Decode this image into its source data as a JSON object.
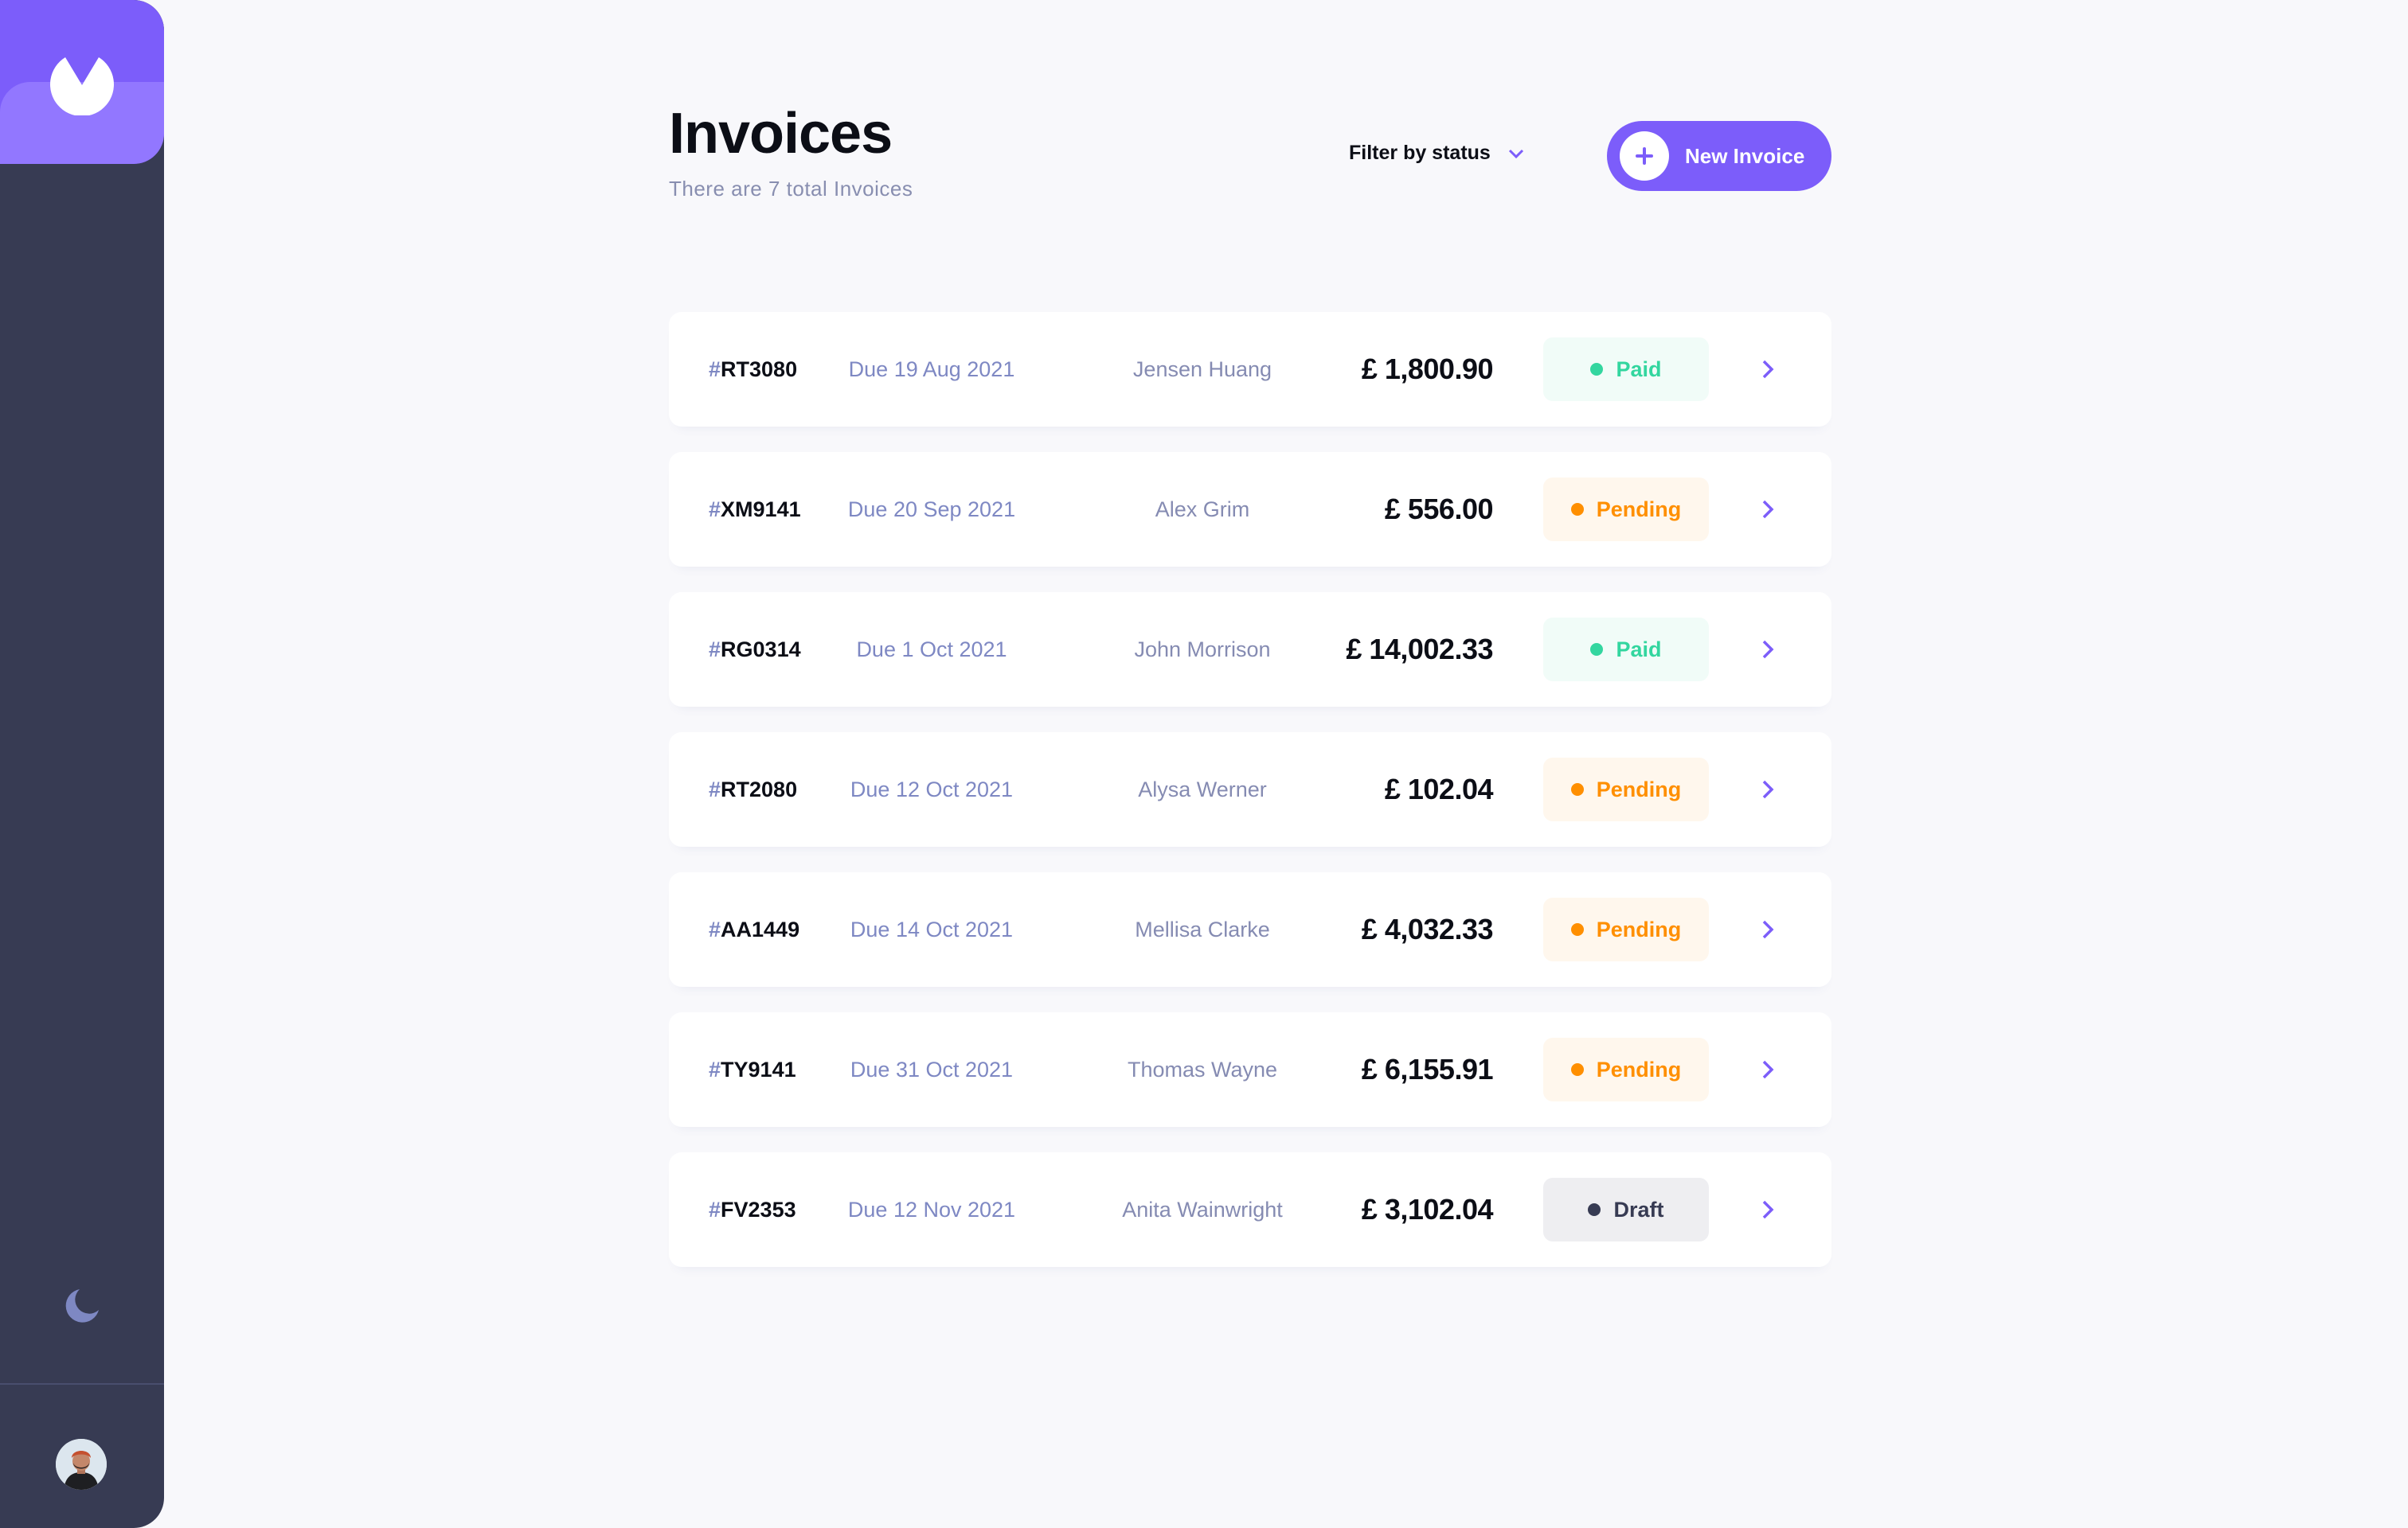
{
  "colors": {
    "accent": "#7C5DFA",
    "accent_light": "#9277FF",
    "sidebar": "#373B53",
    "paid": "#33D69F",
    "pending": "#FF8F00",
    "draft": "#373B53"
  },
  "sidebar": {
    "logo_icon": "logo-icon",
    "theme_toggle_icon": "moon-icon",
    "avatar_icon": "user-avatar"
  },
  "header": {
    "title": "Invoices",
    "subtitle": "There are 7 total Invoices",
    "filter_label": "Filter by status",
    "filter_icon": "chevron-down-icon",
    "new_invoice_label": "New Invoice",
    "new_invoice_icon": "plus-icon"
  },
  "invoices": [
    {
      "id": "RT3080",
      "due": "Due 19 Aug 2021",
      "client": "Jensen Huang",
      "amount": "£ 1,800.90",
      "status": "Paid"
    },
    {
      "id": "XM9141",
      "due": "Due 20 Sep 2021",
      "client": "Alex Grim",
      "amount": "£ 556.00",
      "status": "Pending"
    },
    {
      "id": "RG0314",
      "due": "Due 1 Oct 2021",
      "client": "John Morrison",
      "amount": "£ 14,002.33",
      "status": "Paid"
    },
    {
      "id": "RT2080",
      "due": "Due 12 Oct 2021",
      "client": "Alysa Werner",
      "amount": "£ 102.04",
      "status": "Pending"
    },
    {
      "id": "AA1449",
      "due": "Due 14 Oct 2021",
      "client": "Mellisa Clarke",
      "amount": "£ 4,032.33",
      "status": "Pending"
    },
    {
      "id": "TY9141",
      "due": "Due 31 Oct 2021",
      "client": "Thomas Wayne",
      "amount": "£ 6,155.91",
      "status": "Pending"
    },
    {
      "id": "FV2353",
      "due": "Due 12 Nov 2021",
      "client": "Anita Wainwright",
      "amount": "£ 3,102.04",
      "status": "Draft"
    }
  ]
}
